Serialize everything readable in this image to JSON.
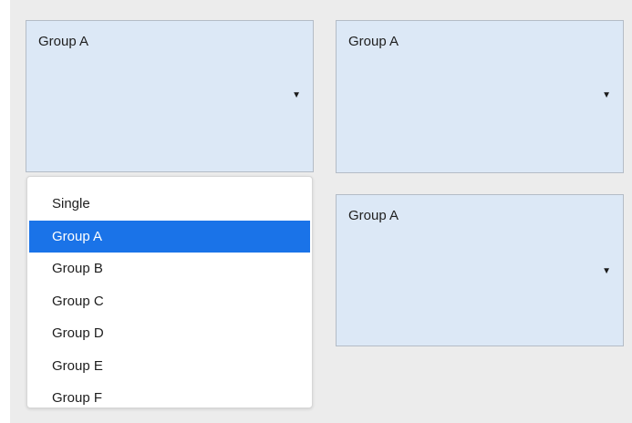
{
  "combos": [
    {
      "selected": "Group A"
    },
    {
      "selected": "Group A"
    },
    {
      "selected": "Group A"
    }
  ],
  "dropdown": {
    "options": [
      {
        "label": "Single",
        "selected": false
      },
      {
        "label": "Group A",
        "selected": true
      },
      {
        "label": "Group B",
        "selected": false
      },
      {
        "label": "Group C",
        "selected": false
      },
      {
        "label": "Group D",
        "selected": false
      },
      {
        "label": "Group E",
        "selected": false
      },
      {
        "label": "Group F",
        "selected": false
      }
    ]
  },
  "colors": {
    "combo_background": "#dce8f6",
    "selection_highlight": "#1a73e8",
    "panel_background": "#ececec"
  },
  "icons": {
    "combo_arrow": "triangle-down-icon"
  }
}
